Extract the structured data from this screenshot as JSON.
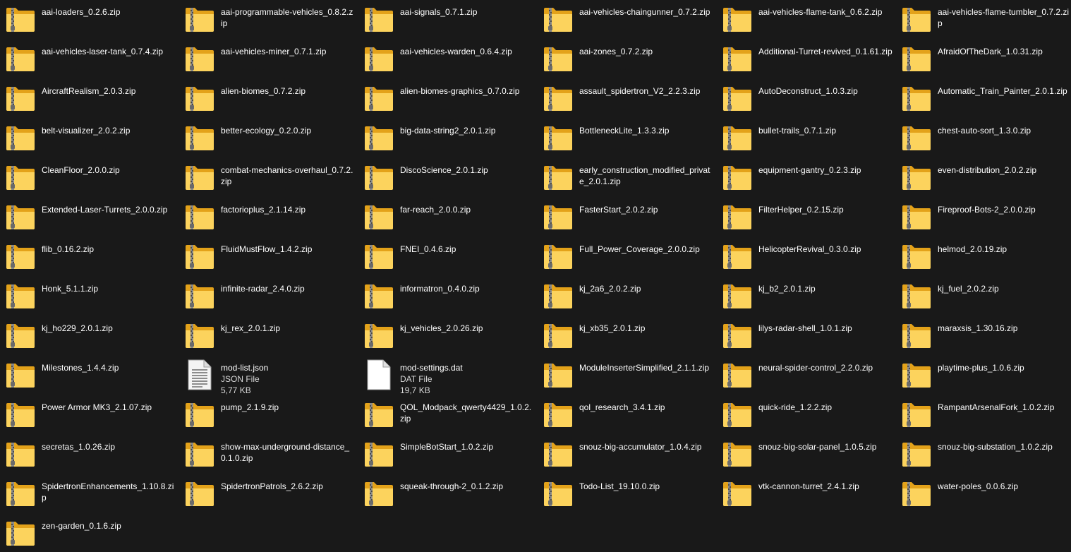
{
  "colors": {
    "background": "#191919",
    "text": "#ffffff",
    "folder_back": "#e3a21a",
    "folder_front": "#fcd35d",
    "zipper": "#7a7a7a"
  },
  "items": [
    {
      "name": "aai-loaders_0.2.6.zip",
      "type": "zip",
      "icon": "zip-folder-icon"
    },
    {
      "name": "aai-programmable-vehicles_0.8.2.zip",
      "type": "zip",
      "icon": "zip-folder-icon"
    },
    {
      "name": "aai-signals_0.7.1.zip",
      "type": "zip",
      "icon": "zip-folder-icon"
    },
    {
      "name": "aai-vehicles-chaingunner_0.7.2.zip",
      "type": "zip",
      "icon": "zip-folder-icon"
    },
    {
      "name": "aai-vehicles-flame-tank_0.6.2.zip",
      "type": "zip",
      "icon": "zip-folder-icon"
    },
    {
      "name": "aai-vehicles-flame-tumbler_0.7.2.zip",
      "type": "zip",
      "icon": "zip-folder-icon"
    },
    {
      "name": "aai-vehicles-laser-tank_0.7.4.zip",
      "type": "zip",
      "icon": "zip-folder-icon"
    },
    {
      "name": "aai-vehicles-miner_0.7.1.zip",
      "type": "zip",
      "icon": "zip-folder-icon"
    },
    {
      "name": "aai-vehicles-warden_0.6.4.zip",
      "type": "zip",
      "icon": "zip-folder-icon"
    },
    {
      "name": "aai-zones_0.7.2.zip",
      "type": "zip",
      "icon": "zip-folder-icon"
    },
    {
      "name": "Additional-Turret-revived_0.1.61.zip",
      "type": "zip",
      "icon": "zip-folder-icon"
    },
    {
      "name": "AfraidOfTheDark_1.0.31.zip",
      "type": "zip",
      "icon": "zip-folder-icon"
    },
    {
      "name": "AircraftRealism_2.0.3.zip",
      "type": "zip",
      "icon": "zip-folder-icon"
    },
    {
      "name": "alien-biomes_0.7.2.zip",
      "type": "zip",
      "icon": "zip-folder-icon"
    },
    {
      "name": "alien-biomes-graphics_0.7.0.zip",
      "type": "zip",
      "icon": "zip-folder-icon"
    },
    {
      "name": "assault_spidertron_V2_2.2.3.zip",
      "type": "zip",
      "icon": "zip-folder-icon"
    },
    {
      "name": "AutoDeconstruct_1.0.3.zip",
      "type": "zip",
      "icon": "zip-folder-icon"
    },
    {
      "name": "Automatic_Train_Painter_2.0.1.zip",
      "type": "zip",
      "icon": "zip-folder-icon"
    },
    {
      "name": "belt-visualizer_2.0.2.zip",
      "type": "zip",
      "icon": "zip-folder-icon"
    },
    {
      "name": "better-ecology_0.2.0.zip",
      "type": "zip",
      "icon": "zip-folder-icon"
    },
    {
      "name": "big-data-string2_2.0.1.zip",
      "type": "zip",
      "icon": "zip-folder-icon"
    },
    {
      "name": "BottleneckLite_1.3.3.zip",
      "type": "zip",
      "icon": "zip-folder-icon"
    },
    {
      "name": "bullet-trails_0.7.1.zip",
      "type": "zip",
      "icon": "zip-folder-icon"
    },
    {
      "name": "chest-auto-sort_1.3.0.zip",
      "type": "zip",
      "icon": "zip-folder-icon"
    },
    {
      "name": "CleanFloor_2.0.0.zip",
      "type": "zip",
      "icon": "zip-folder-icon"
    },
    {
      "name": "combat-mechanics-overhaul_0.7.2.zip",
      "type": "zip",
      "icon": "zip-folder-icon"
    },
    {
      "name": "DiscoScience_2.0.1.zip",
      "type": "zip",
      "icon": "zip-folder-icon"
    },
    {
      "name": "early_construction_modified_private_2.0.1.zip",
      "type": "zip",
      "icon": "zip-folder-icon"
    },
    {
      "name": "equipment-gantry_0.2.3.zip",
      "type": "zip",
      "icon": "zip-folder-icon"
    },
    {
      "name": "even-distribution_2.0.2.zip",
      "type": "zip",
      "icon": "zip-folder-icon"
    },
    {
      "name": "Extended-Laser-Turrets_2.0.0.zip",
      "type": "zip",
      "icon": "zip-folder-icon"
    },
    {
      "name": "factorioplus_2.1.14.zip",
      "type": "zip",
      "icon": "zip-folder-icon"
    },
    {
      "name": "far-reach_2.0.0.zip",
      "type": "zip",
      "icon": "zip-folder-icon"
    },
    {
      "name": "FasterStart_2.0.2.zip",
      "type": "zip",
      "icon": "zip-folder-icon"
    },
    {
      "name": "FilterHelper_0.2.15.zip",
      "type": "zip",
      "icon": "zip-folder-icon"
    },
    {
      "name": "Fireproof-Bots-2_2.0.0.zip",
      "type": "zip",
      "icon": "zip-folder-icon"
    },
    {
      "name": "flib_0.16.2.zip",
      "type": "zip",
      "icon": "zip-folder-icon"
    },
    {
      "name": "FluidMustFlow_1.4.2.zip",
      "type": "zip",
      "icon": "zip-folder-icon"
    },
    {
      "name": "FNEI_0.4.6.zip",
      "type": "zip",
      "icon": "zip-folder-icon"
    },
    {
      "name": "Full_Power_Coverage_2.0.0.zip",
      "type": "zip",
      "icon": "zip-folder-icon"
    },
    {
      "name": "HelicopterRevival_0.3.0.zip",
      "type": "zip",
      "icon": "zip-folder-icon"
    },
    {
      "name": "helmod_2.0.19.zip",
      "type": "zip",
      "icon": "zip-folder-icon"
    },
    {
      "name": "Honk_5.1.1.zip",
      "type": "zip",
      "icon": "zip-folder-icon"
    },
    {
      "name": "infinite-radar_2.4.0.zip",
      "type": "zip",
      "icon": "zip-folder-icon"
    },
    {
      "name": "informatron_0.4.0.zip",
      "type": "zip",
      "icon": "zip-folder-icon"
    },
    {
      "name": "kj_2a6_2.0.2.zip",
      "type": "zip",
      "icon": "zip-folder-icon"
    },
    {
      "name": "kj_b2_2.0.1.zip",
      "type": "zip",
      "icon": "zip-folder-icon"
    },
    {
      "name": "kj_fuel_2.0.2.zip",
      "type": "zip",
      "icon": "zip-folder-icon"
    },
    {
      "name": "kj_ho229_2.0.1.zip",
      "type": "zip",
      "icon": "zip-folder-icon"
    },
    {
      "name": "kj_rex_2.0.1.zip",
      "type": "zip",
      "icon": "zip-folder-icon"
    },
    {
      "name": "kj_vehicles_2.0.26.zip",
      "type": "zip",
      "icon": "zip-folder-icon"
    },
    {
      "name": "kj_xb35_2.0.1.zip",
      "type": "zip",
      "icon": "zip-folder-icon"
    },
    {
      "name": "lilys-radar-shell_1.0.1.zip",
      "type": "zip",
      "icon": "zip-folder-icon"
    },
    {
      "name": "maraxsis_1.30.16.zip",
      "type": "zip",
      "icon": "zip-folder-icon"
    },
    {
      "name": "Milestones_1.4.4.zip",
      "type": "zip",
      "icon": "zip-folder-icon"
    },
    {
      "name": "mod-list.json",
      "type": "file",
      "icon": "text-document-icon",
      "kind": "JSON File",
      "size": "5,77 KB"
    },
    {
      "name": "mod-settings.dat",
      "type": "file",
      "icon": "blank-document-icon",
      "kind": "DAT File",
      "size": "19,7 KB"
    },
    {
      "name": "ModuleInserterSimplified_2.1.1.zip",
      "type": "zip",
      "icon": "zip-folder-icon"
    },
    {
      "name": "neural-spider-control_2.2.0.zip",
      "type": "zip",
      "icon": "zip-folder-icon"
    },
    {
      "name": "playtime-plus_1.0.6.zip",
      "type": "zip",
      "icon": "zip-folder-icon"
    },
    {
      "name": "Power Armor MK3_2.1.07.zip",
      "type": "zip",
      "icon": "zip-folder-icon"
    },
    {
      "name": "pump_2.1.9.zip",
      "type": "zip",
      "icon": "zip-folder-icon"
    },
    {
      "name": "QOL_Modpack_qwerty4429_1.0.2.zip",
      "type": "zip",
      "icon": "zip-folder-icon"
    },
    {
      "name": "qol_research_3.4.1.zip",
      "type": "zip",
      "icon": "zip-folder-icon"
    },
    {
      "name": "quick-ride_1.2.2.zip",
      "type": "zip",
      "icon": "zip-folder-icon"
    },
    {
      "name": "RampantArsenalFork_1.0.2.zip",
      "type": "zip",
      "icon": "zip-folder-icon"
    },
    {
      "name": "secretas_1.0.26.zip",
      "type": "zip",
      "icon": "zip-folder-icon"
    },
    {
      "name": "show-max-underground-distance_0.1.0.zip",
      "type": "zip",
      "icon": "zip-folder-icon"
    },
    {
      "name": "SimpleBotStart_1.0.2.zip",
      "type": "zip",
      "icon": "zip-folder-icon"
    },
    {
      "name": "snouz-big-accumulator_1.0.4.zip",
      "type": "zip",
      "icon": "zip-folder-icon"
    },
    {
      "name": "snouz-big-solar-panel_1.0.5.zip",
      "type": "zip",
      "icon": "zip-folder-icon"
    },
    {
      "name": "snouz-big-substation_1.0.2.zip",
      "type": "zip",
      "icon": "zip-folder-icon"
    },
    {
      "name": "SpidertronEnhancements_1.10.8.zip",
      "type": "zip",
      "icon": "zip-folder-icon"
    },
    {
      "name": "SpidertronPatrols_2.6.2.zip",
      "type": "zip",
      "icon": "zip-folder-icon"
    },
    {
      "name": "squeak-through-2_0.1.2.zip",
      "type": "zip",
      "icon": "zip-folder-icon"
    },
    {
      "name": "Todo-List_19.10.0.zip",
      "type": "zip",
      "icon": "zip-folder-icon"
    },
    {
      "name": "vtk-cannon-turret_2.4.1.zip",
      "type": "zip",
      "icon": "zip-folder-icon"
    },
    {
      "name": "water-poles_0.0.6.zip",
      "type": "zip",
      "icon": "zip-folder-icon"
    },
    {
      "name": "zen-garden_0.1.6.zip",
      "type": "zip",
      "icon": "zip-folder-icon"
    }
  ]
}
